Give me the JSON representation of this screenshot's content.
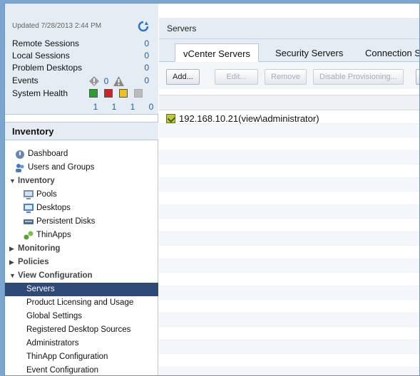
{
  "summary": {
    "updated": "Updated 7/28/2013 2:44 PM",
    "rows": [
      {
        "label": "Remote Sessions",
        "value": "0"
      },
      {
        "label": "Local Sessions",
        "value": "0"
      },
      {
        "label": "Problem Desktops",
        "value": "0"
      },
      {
        "label": "Events",
        "value": "0",
        "value2": "0"
      },
      {
        "label": "System Health"
      }
    ],
    "health_counts": [
      "1",
      "1",
      "1",
      "0"
    ],
    "health_colors": [
      "#2aa02a",
      "#cc2222",
      "#f0c020",
      "#bbbbbb"
    ]
  },
  "inventory_header": "Inventory",
  "nav": {
    "dashboard": "Dashboard",
    "users_groups": "Users and Groups",
    "inventory": "Inventory",
    "pools": "Pools",
    "desktops": "Desktops",
    "persistent_disks": "Persistent Disks",
    "thinapps": "ThinApps",
    "monitoring": "Monitoring",
    "policies": "Policies",
    "view_config": "View Configuration",
    "servers": "Servers",
    "product_licensing": "Product Licensing and Usage",
    "global_settings": "Global Settings",
    "registered_sources": "Registered Desktop Sources",
    "administrators": "Administrators",
    "thinapp_config": "ThinApp Configuration",
    "event_config": "Event Configuration"
  },
  "main": {
    "title": "Servers",
    "tabs": [
      "vCenter Servers",
      "Security Servers",
      "Connection S"
    ],
    "toolbar": {
      "add": "Add...",
      "edit": "Edit...",
      "remove": "Remove",
      "disable": "Disable Provisioning..."
    },
    "servers": [
      "192.168.10.21(view\\administrator)"
    ]
  }
}
